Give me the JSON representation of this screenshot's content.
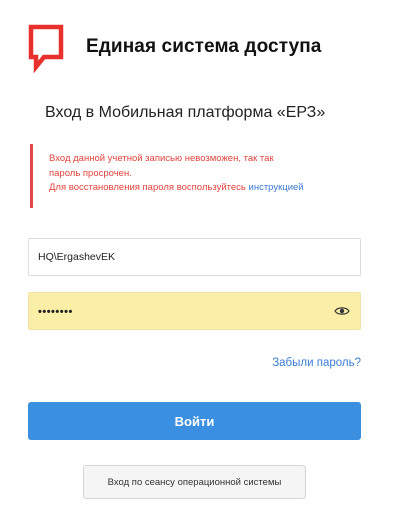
{
  "header": {
    "system_title": "Единая система доступа",
    "logo_color": "#e8302d"
  },
  "login": {
    "title": "Вход в Мобильная платформа «ЕРЗ»"
  },
  "alert": {
    "line1": "Вход данной учетной записью невозможен, так так",
    "line2": "пароль просрочен.",
    "line3_prefix": "Для восстановления пароля воспользуйтесь ",
    "line3_link": "инструкцией",
    "border_color": "#e24a48",
    "text_color": "#e2433d"
  },
  "form": {
    "username_value": "HQ\\ErgashevEK",
    "password_value": "••••••••",
    "password_autofill_bg": "#fbefa8",
    "eye_icon": "eye-icon",
    "forgot_label": "Забыли пароль?",
    "submit_label": "Войти",
    "submit_color": "#3a8fe0",
    "os_login_label": "Вход по сеансу операционной системы"
  }
}
